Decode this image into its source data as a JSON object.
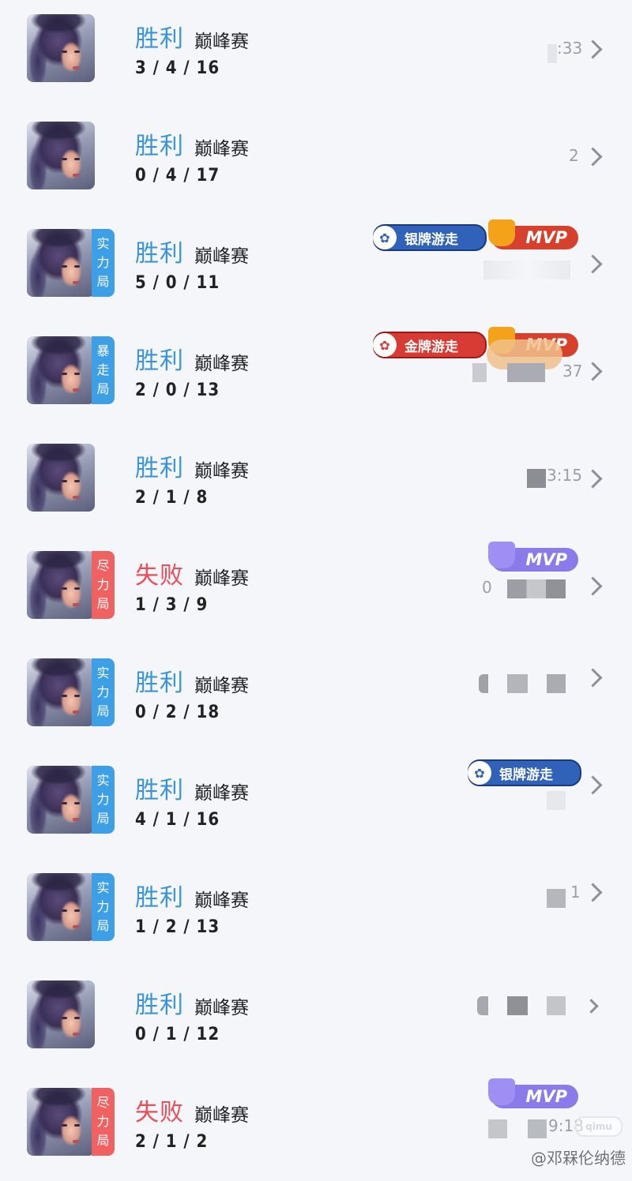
{
  "matches": [
    {
      "result": "胜利",
      "outcome": "win",
      "mode": "巅峰赛",
      "kda": "3 / 4 / 16",
      "tag": null,
      "meta": ":33",
      "badges": []
    },
    {
      "result": "胜利",
      "outcome": "win",
      "mode": "巅峰赛",
      "kda": "0 / 4 / 17",
      "tag": null,
      "meta": "2",
      "badges": []
    },
    {
      "result": "胜利",
      "outcome": "win",
      "mode": "巅峰赛",
      "kda": "5 / 0 / 11",
      "tag": "实力局",
      "tag_color": "blue",
      "meta": "",
      "badges": [
        "银牌游走",
        "MVP"
      ]
    },
    {
      "result": "胜利",
      "outcome": "win",
      "mode": "巅峰赛",
      "kda": "2 / 0 / 13",
      "tag": "暴走局",
      "tag_color": "blue",
      "meta": "37",
      "badges": [
        "金牌游走",
        "MVP"
      ]
    },
    {
      "result": "胜利",
      "outcome": "win",
      "mode": "巅峰赛",
      "kda": "2 / 1 / 8",
      "tag": null,
      "meta": "3:15",
      "badges": []
    },
    {
      "result": "失败",
      "outcome": "lose",
      "mode": "巅峰赛",
      "kda": "1 / 3 / 9",
      "tag": "尽力局",
      "tag_color": "red",
      "meta": "0",
      "badges": [
        "MVP"
      ]
    },
    {
      "result": "胜利",
      "outcome": "win",
      "mode": "巅峰赛",
      "kda": "0 / 2 / 18",
      "tag": "实力局",
      "tag_color": "blue",
      "meta": "",
      "badges": []
    },
    {
      "result": "胜利",
      "outcome": "win",
      "mode": "巅峰赛",
      "kda": "4 / 1 / 16",
      "tag": "实力局",
      "tag_color": "blue",
      "meta": "",
      "badges": [
        "银牌游走"
      ]
    },
    {
      "result": "胜利",
      "outcome": "win",
      "mode": "巅峰赛",
      "kda": "1 / 2 / 13",
      "tag": "实力局",
      "tag_color": "blue",
      "meta": "1",
      "badges": []
    },
    {
      "result": "胜利",
      "outcome": "win",
      "mode": "巅峰赛",
      "kda": "0 / 1 / 12",
      "tag": null,
      "meta": "",
      "badges": []
    },
    {
      "result": "失败",
      "outcome": "lose",
      "mode": "巅峰赛",
      "kda": "2 / 1 / 2",
      "tag": "尽力局",
      "tag_color": "red",
      "meta": "9:18",
      "badges": [
        "MVP"
      ]
    }
  ],
  "watermark": "@邓槑伦纳德",
  "watermark_logo": "qimu",
  "colors": {
    "win": "#3a95d8",
    "lose": "#ec4c56",
    "tag_blue": "#3d9fe6",
    "tag_red": "#f06262"
  }
}
